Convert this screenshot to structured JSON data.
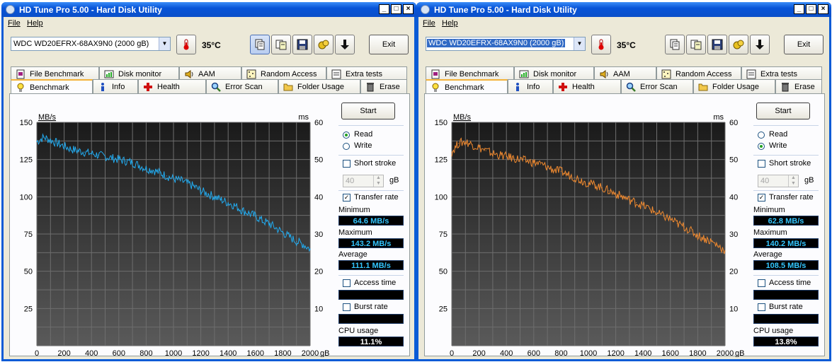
{
  "windows": [
    {
      "title": "HD Tune Pro 5.00 - Hard Disk Utility",
      "menu": [
        "File",
        "Help"
      ],
      "drive": "WDC WD20EFRX-68AX9N0     (2000 gB)",
      "drive_selected": false,
      "temperature": "35°C",
      "exit_label": "Exit",
      "tabs_top": [
        "File Benchmark",
        "Disk monitor",
        "AAM",
        "Random Access",
        "Extra tests"
      ],
      "tabs_bottom": [
        "Benchmark",
        "Info",
        "Health",
        "Error Scan",
        "Folder Usage",
        "Erase"
      ],
      "selected_tab": "Benchmark",
      "start_label": "Start",
      "mode": "Read",
      "read_label": "Read",
      "write_label": "Write",
      "short_stroke_label": "Short stroke",
      "short_stroke_value": "40",
      "gb_label": "gB",
      "transfer_rate_label": "Transfer rate",
      "minimum_label": "Minimum",
      "minimum": "64.6 MB/s",
      "maximum_label": "Maximum",
      "maximum": "143.2 MB/s",
      "average_label": "Average",
      "average": "111.1 MB/s",
      "access_time_label": "Access time",
      "burst_rate_label": "Burst rate",
      "cpu_usage_label": "CPU usage",
      "cpu_usage": "11.1%",
      "line_color": "#22aaee"
    },
    {
      "title": "HD Tune Pro 5.00 - Hard Disk Utility",
      "menu": [
        "File",
        "Help"
      ],
      "drive": "WDC WD20EFRX-68AX9N0     (2000 gB)",
      "drive_selected": true,
      "temperature": "35°C",
      "exit_label": "Exit",
      "tabs_top": [
        "File Benchmark",
        "Disk monitor",
        "AAM",
        "Random Access",
        "Extra tests"
      ],
      "tabs_bottom": [
        "Benchmark",
        "Info",
        "Health",
        "Error Scan",
        "Folder Usage",
        "Erase"
      ],
      "selected_tab": "Benchmark",
      "start_label": "Start",
      "mode": "Write",
      "read_label": "Read",
      "write_label": "Write",
      "short_stroke_label": "Short stroke",
      "short_stroke_value": "40",
      "gb_label": "gB",
      "transfer_rate_label": "Transfer rate",
      "minimum_label": "Minimum",
      "minimum": "62.8 MB/s",
      "maximum_label": "Maximum",
      "maximum": "140.2 MB/s",
      "average_label": "Average",
      "average": "108.5 MB/s",
      "access_time_label": "Access time",
      "burst_rate_label": "Burst rate",
      "cpu_usage_label": "CPU usage",
      "cpu_usage": "13.8%",
      "line_color": "#f08a30"
    }
  ],
  "chart_data": [
    {
      "type": "line",
      "ylabel": "MB/s",
      "y2label": "ms",
      "xlabel": "gB",
      "xlim": [
        0,
        2000
      ],
      "ylim": [
        0,
        150
      ],
      "y2lim": [
        0,
        60
      ],
      "xticks": [
        0,
        200,
        400,
        600,
        800,
        1000,
        1200,
        1400,
        1600,
        1800,
        2000
      ],
      "yticks": [
        25,
        50,
        75,
        100,
        125,
        150
      ],
      "y2ticks": [
        10,
        20,
        30,
        40,
        50,
        60
      ],
      "grid": true,
      "series": [
        {
          "x": [
            0,
            50,
            100,
            150,
            200,
            250,
            300,
            350,
            400,
            450,
            500,
            550,
            600,
            650,
            700,
            750,
            800,
            850,
            900,
            950,
            1000,
            1050,
            1100,
            1150,
            1200,
            1250,
            1300,
            1350,
            1400,
            1450,
            1500,
            1550,
            1600,
            1650,
            1700,
            1750,
            1800,
            1850,
            1900,
            1950,
            2000
          ],
          "y": [
            137,
            140,
            138,
            136,
            134,
            132,
            131,
            130,
            129,
            128,
            127,
            126,
            125,
            124,
            123,
            121,
            119,
            118,
            116,
            114,
            112,
            111,
            109,
            107,
            104,
            102,
            100,
            98,
            96,
            94,
            91,
            89,
            87,
            84,
            82,
            79,
            76,
            73,
            70,
            68,
            65
          ]
        }
      ]
    },
    {
      "type": "line",
      "ylabel": "MB/s",
      "y2label": "ms",
      "xlabel": "gB",
      "xlim": [
        0,
        2000
      ],
      "ylim": [
        0,
        150
      ],
      "y2lim": [
        0,
        60
      ],
      "xticks": [
        0,
        200,
        400,
        600,
        800,
        1000,
        1200,
        1400,
        1600,
        1800,
        2000
      ],
      "yticks": [
        25,
        50,
        75,
        100,
        125,
        150
      ],
      "y2ticks": [
        10,
        20,
        30,
        40,
        50,
        60
      ],
      "grid": true,
      "series": [
        {
          "x": [
            0,
            50,
            100,
            150,
            200,
            250,
            300,
            350,
            400,
            450,
            500,
            550,
            600,
            650,
            700,
            750,
            800,
            850,
            900,
            950,
            1000,
            1050,
            1100,
            1150,
            1200,
            1250,
            1300,
            1350,
            1400,
            1450,
            1500,
            1550,
            1600,
            1650,
            1700,
            1750,
            1800,
            1850,
            1900,
            1950,
            2000
          ],
          "y": [
            130,
            136,
            137,
            135,
            133,
            131,
            129,
            128,
            127,
            126,
            125,
            124,
            123,
            122,
            120,
            118,
            117,
            115,
            113,
            111,
            109,
            108,
            106,
            104,
            102,
            100,
            98,
            96,
            94,
            92,
            89,
            87,
            85,
            82,
            80,
            77,
            74,
            72,
            70,
            67,
            64
          ]
        }
      ]
    }
  ]
}
